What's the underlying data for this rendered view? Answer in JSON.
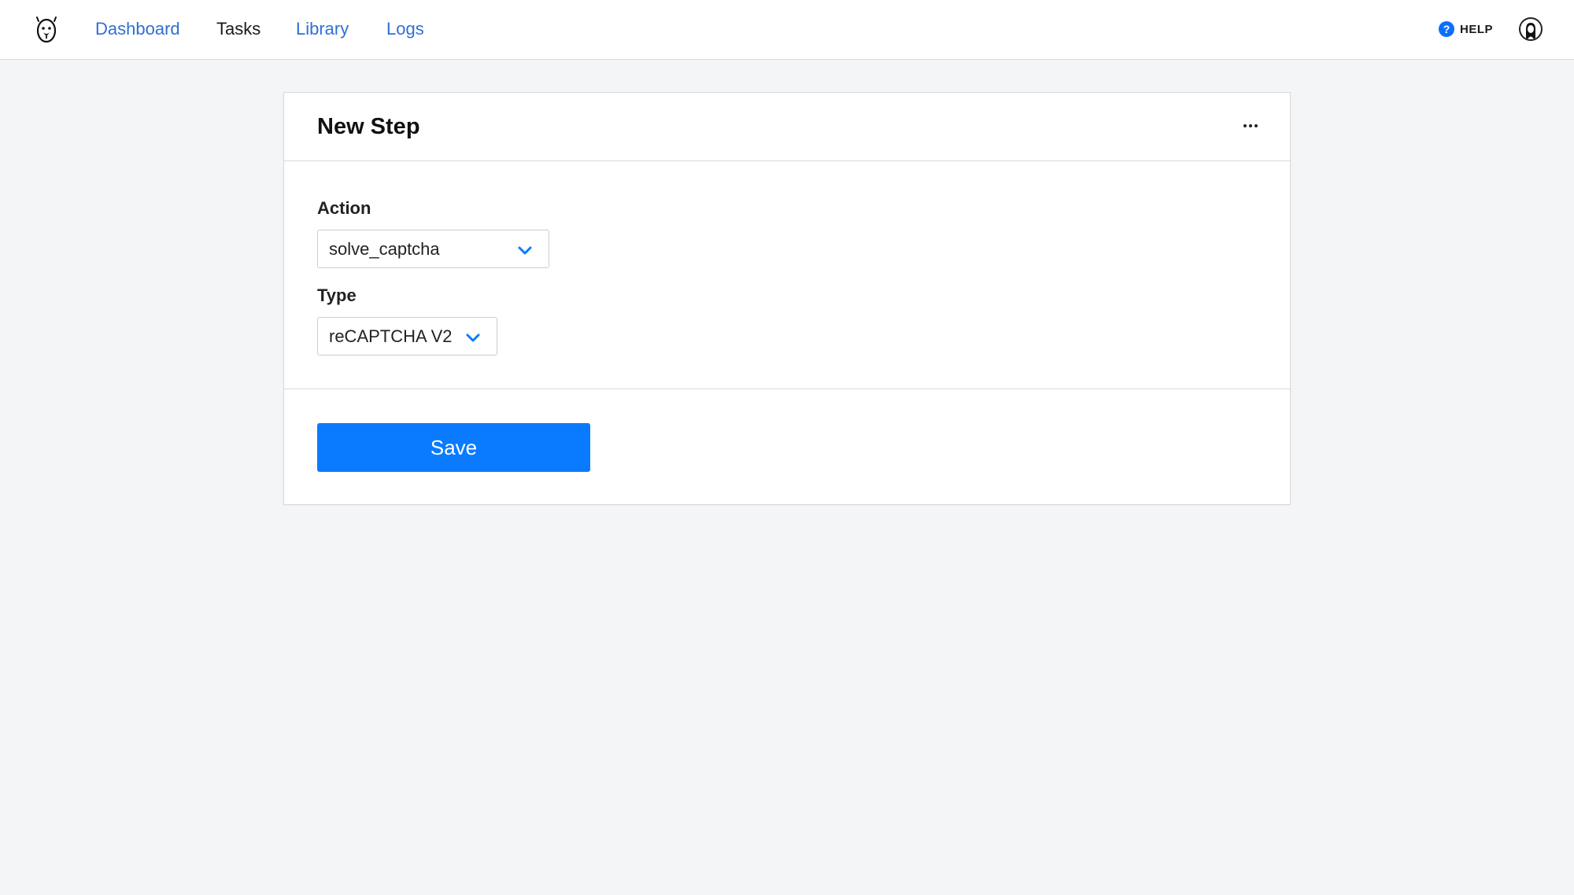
{
  "nav": {
    "items": [
      {
        "label": "Dashboard",
        "active": false
      },
      {
        "label": "Tasks",
        "active": true
      },
      {
        "label": "Library",
        "active": false
      },
      {
        "label": "Logs",
        "active": false
      }
    ],
    "help_label": "HELP",
    "help_icon": "question-circle-icon",
    "logo_icon": "bear-logo-icon",
    "avatar_icon": "user-avatar-icon"
  },
  "card": {
    "title": "New Step",
    "more_icon": "ellipsis-icon",
    "fields": {
      "action": {
        "label": "Action",
        "value": "solve_captcha"
      },
      "type": {
        "label": "Type",
        "value": "reCAPTCHA V2"
      }
    },
    "save_label": "Save"
  },
  "colors": {
    "accent": "#0a7bff",
    "link": "#2f6fd6",
    "background": "#f4f5f7",
    "border": "#d7d9dd"
  }
}
